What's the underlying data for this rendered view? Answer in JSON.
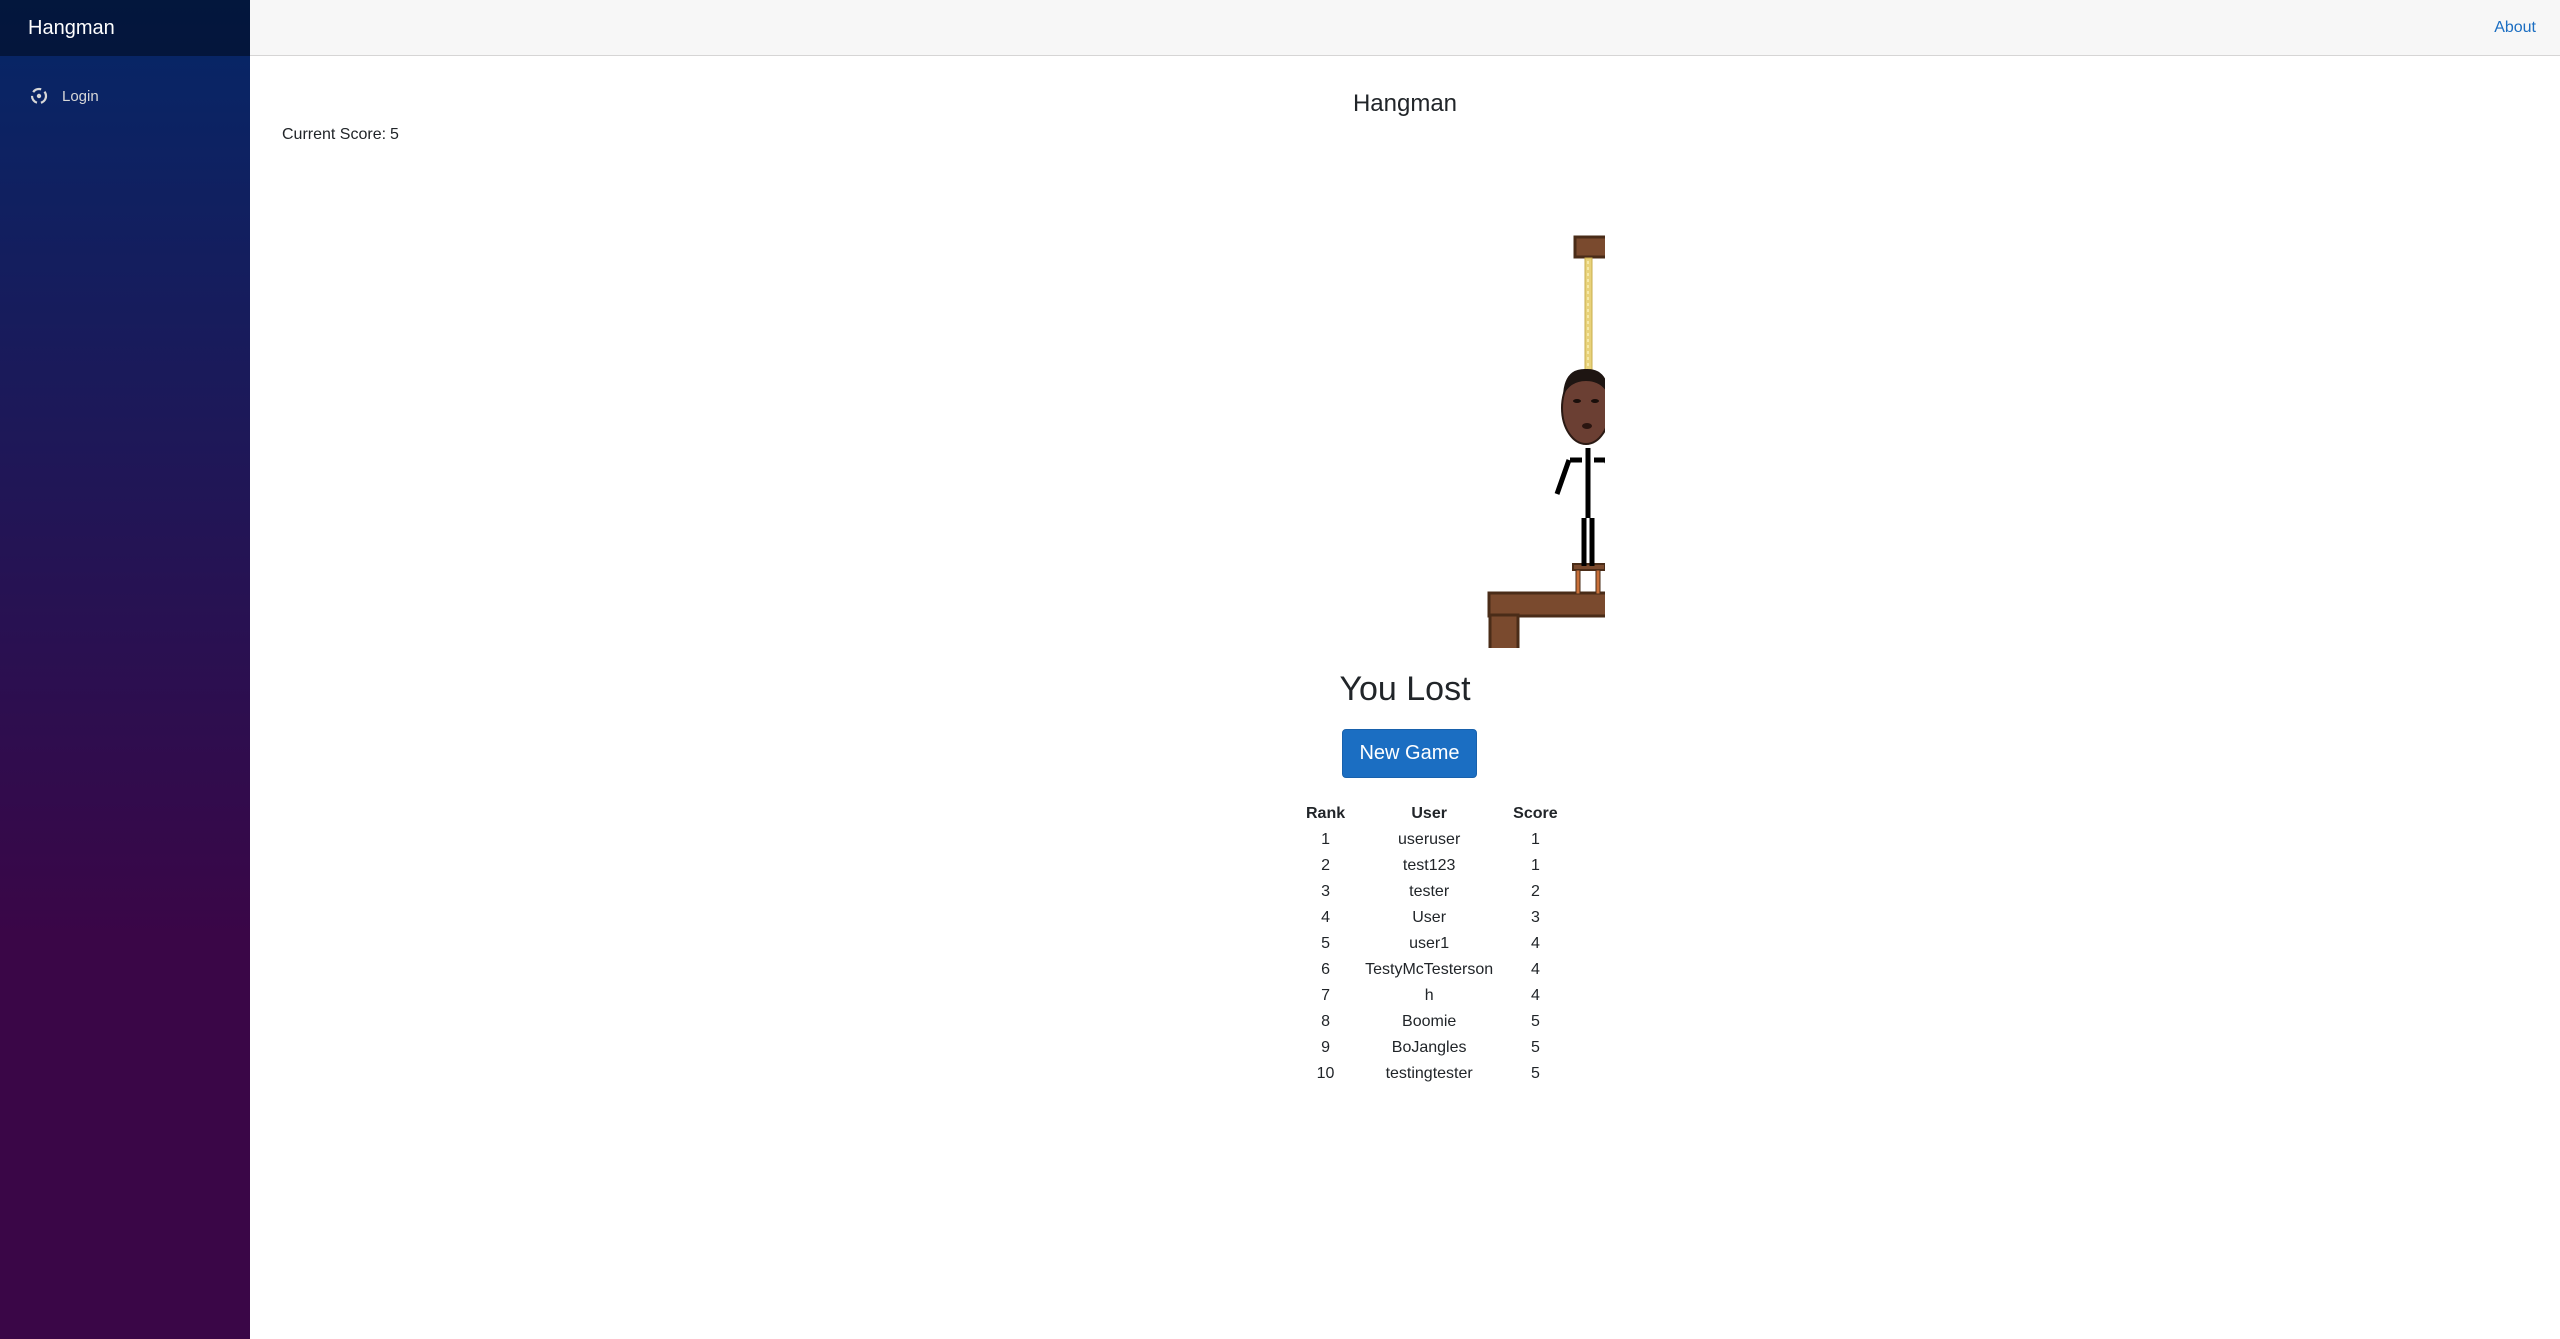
{
  "app": {
    "brand": "Hangman"
  },
  "sidebar": {
    "items": [
      {
        "label": "Login",
        "icon": "login-icon"
      }
    ]
  },
  "topbar": {
    "about_label": "About"
  },
  "game": {
    "title": "Hangman",
    "score_label": "Current Score:",
    "score_value": "5",
    "status": "You Lost",
    "new_game_label": "New Game"
  },
  "leaderboard": {
    "headers": [
      "Rank",
      "User",
      "Score"
    ],
    "rows": [
      {
        "rank": "1",
        "user": "useruser",
        "score": "1"
      },
      {
        "rank": "2",
        "user": "test123",
        "score": "1"
      },
      {
        "rank": "3",
        "user": "tester",
        "score": "2"
      },
      {
        "rank": "4",
        "user": "User",
        "score": "3"
      },
      {
        "rank": "5",
        "user": "user1",
        "score": "4"
      },
      {
        "rank": "6",
        "user": "TestyMcTesterson",
        "score": "4"
      },
      {
        "rank": "7",
        "user": "h",
        "score": "4"
      },
      {
        "rank": "8",
        "user": "Boomie",
        "score": "5"
      },
      {
        "rank": "9",
        "user": "BoJangles",
        "score": "5"
      },
      {
        "rank": "10",
        "user": "testingtester",
        "score": "5"
      }
    ]
  },
  "colors": {
    "accent": "#1b6ec2",
    "wood": "#7a4a2e",
    "wood_outline": "#4a2c18",
    "rope": "#e8d27a",
    "sidebar_top": "#052767",
    "sidebar_bottom": "#3a0647"
  }
}
